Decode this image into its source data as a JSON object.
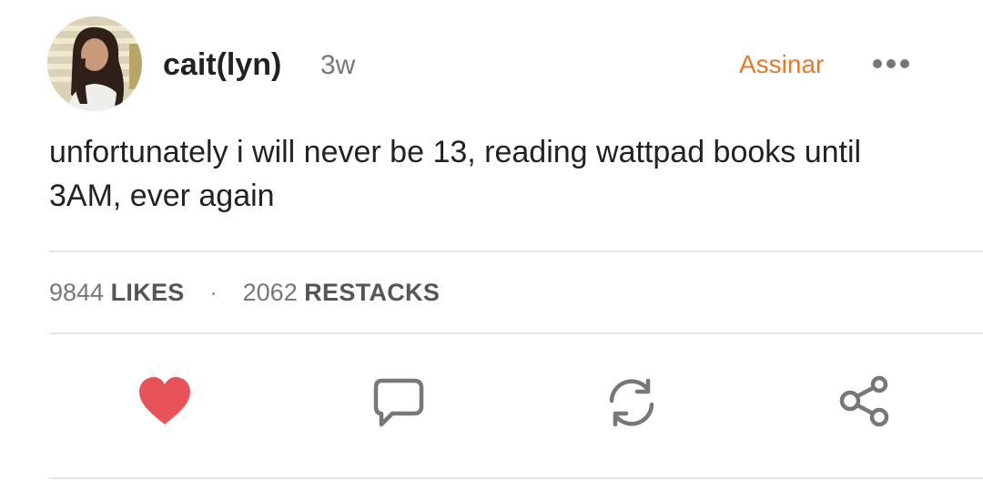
{
  "post": {
    "author": "cait(lyn)",
    "age": "3w",
    "subscribe_label": "Assinar",
    "text": "unfortunately i will never be 13, reading wattpad books until 3AM, ever again"
  },
  "stats": {
    "likes_count": "9844",
    "likes_label": "LIKES",
    "separator": "·",
    "restacks_count": "2062",
    "restacks_label": "RESTACKS"
  },
  "actions": {
    "like_icon": "heart-icon",
    "comment_icon": "speech-bubble-icon",
    "restack_icon": "refresh-arrows-icon",
    "share_icon": "share-icon",
    "like_state": "liked"
  },
  "colors": {
    "accent": "#e07a2f",
    "heart": "#e8535a",
    "icon": "#777777",
    "text": "#222222",
    "muted": "#777777"
  }
}
